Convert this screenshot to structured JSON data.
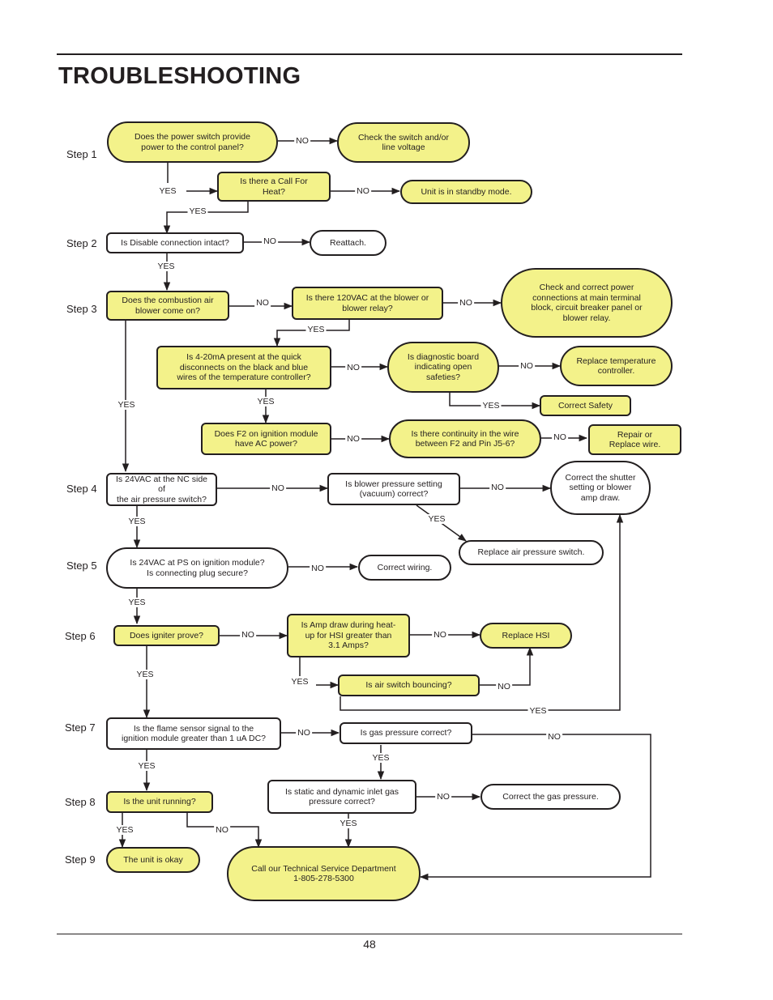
{
  "page": {
    "title": "TROUBLESHOOTING",
    "page_number": "48"
  },
  "colors": {
    "node_fill": "#f3f28a",
    "line": "#231f20"
  },
  "steps": [
    "Step 1",
    "Step 2",
    "Step 3",
    "Step 4",
    "Step 5",
    "Step 6",
    "Step 7",
    "Step 8",
    "Step 9"
  ],
  "nodes": {
    "power_switch": "Does the power switch provide\npower to the control panel?",
    "check_switch": "Check the switch and/or\nline voltage",
    "call_for_heat": "Is there a Call For\nHeat?",
    "standby": "Unit is in standby mode.",
    "disable_conn": "Is Disable connection intact?",
    "reattach": "Reattach.",
    "blower_on": "Does the combustion air\nblower come on?",
    "vac120": "Is there 120VAC at the blower or\nblower relay?",
    "check_power": "Check and correct power\nconnections at main terminal\nblock, circuit breaker panel or\nblower relay.",
    "ma420": "Is 4-20mA present at the quick\ndisconnects on the black and blue\nwires of the temperature controller?",
    "diag_board": "Is diagnostic board\nindicating open\nsafeties?",
    "replace_temp": "Replace temperature\ncontroller.",
    "correct_safety": "Correct Safety",
    "f2_power": "Does F2 on ignition module\nhave AC power?",
    "continuity": "Is there continuity in the wire\nbetween F2 and Pin J5-6?",
    "repair_wire": "Repair or\nReplace wire.",
    "vac24_nc": "Is 24VAC at the NC side of\nthe air pressure switch?",
    "blower_pressure": "Is blower pressure setting\n(vacuum) correct?",
    "correct_shutter": "Correct the shutter\nsetting or blower\namp draw.",
    "replace_aps": "Replace air pressure switch.",
    "vac24_ps": "Is 24VAC at PS on ignition module?\nIs connecting plug secure?",
    "correct_wiring": "Correct wiring.",
    "igniter": "Does igniter prove?",
    "amp_draw": "Is Amp draw during heat-\nup for HSI greater than\n3.1 Amps?",
    "replace_hsi": "Replace HSI",
    "air_switch": "Is air switch bouncing?",
    "flame_sensor": "Is the flame sensor signal to the\nignition module greater than 1 uA DC?",
    "gas_pressure": "Is gas pressure correct?",
    "inlet_gas": "Is static and dynamic inlet gas\npressure correct?",
    "correct_gas": "Correct the gas pressure.",
    "unit_running": "Is the unit running?",
    "unit_okay": "The unit is okay",
    "call_service": "Call our Technical Service Department\n1-805-278-5300"
  },
  "labels": {
    "yes": "YES",
    "no": "NO"
  }
}
